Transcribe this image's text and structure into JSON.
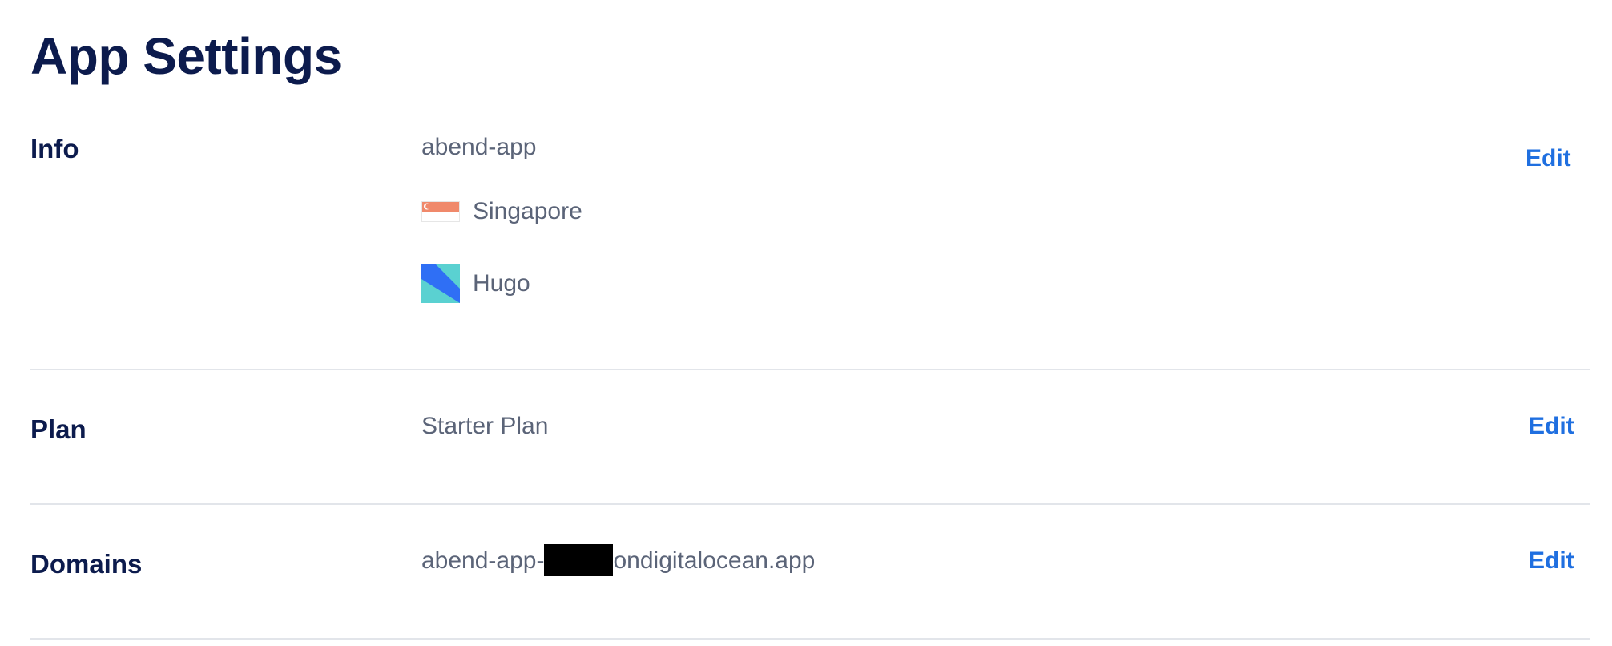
{
  "page": {
    "title": "App Settings"
  },
  "info": {
    "label": "Info",
    "app_name": "abend-app",
    "region": {
      "name": "Singapore",
      "icon": "singapore-flag-icon"
    },
    "framework": {
      "name": "Hugo",
      "icon": "hugo-logo-icon"
    },
    "edit_label": "Edit"
  },
  "plan": {
    "label": "Plan",
    "value": "Starter Plan",
    "edit_label": "Edit"
  },
  "domains": {
    "label": "Domains",
    "value_prefix": "abend-app-",
    "value_suffix": "ondigitalocean.app",
    "edit_label": "Edit"
  },
  "colors": {
    "title": "#0c1b4d",
    "value_text": "#5b6478",
    "link": "#1f6fe0",
    "divider": "#e2e5ea"
  }
}
